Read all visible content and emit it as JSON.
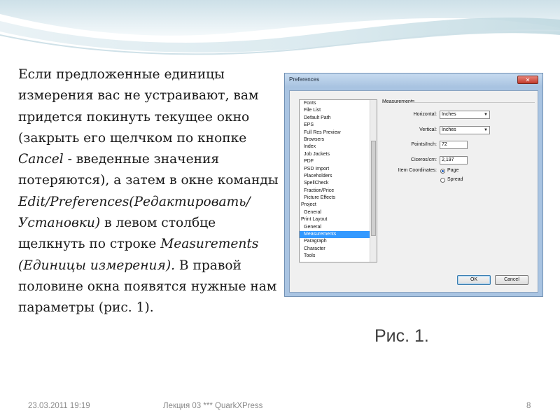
{
  "slide": {
    "paragraph": [
      {
        "text": "Если предложенные единицы измерения вас не устраивают, вам придется покинуть текущее окно (закрыть его щелчком по кнопке ",
        "italic": false
      },
      {
        "text": "Cancel",
        "italic": true
      },
      {
        "text": " - введенные значения потеряются), а затем в окне команды ",
        "italic": false
      },
      {
        "text": "Edit/Preferences(Редактировать/Установки)",
        "italic": true
      },
      {
        "text": " в левом столбце щелкнуть по строке ",
        "italic": false
      },
      {
        "text": "Measurements (Единицы измерения).",
        "italic": true
      },
      {
        "text": " В правой половине окна появятся нужные нам параметры (рис. 1).",
        "italic": false
      }
    ],
    "caption": "Рис. 1."
  },
  "dialog": {
    "title": "Preferences",
    "close_label": "✕",
    "categories": [
      {
        "label": "Fonts",
        "level": 1,
        "selected": false
      },
      {
        "label": "File List",
        "level": 1,
        "selected": false
      },
      {
        "label": "Default Path",
        "level": 1,
        "selected": false
      },
      {
        "label": "EPS",
        "level": 1,
        "selected": false
      },
      {
        "label": "Full Res Preview",
        "level": 1,
        "selected": false
      },
      {
        "label": "Browsers",
        "level": 1,
        "selected": false
      },
      {
        "label": "Index",
        "level": 1,
        "selected": false
      },
      {
        "label": "Job Jackets",
        "level": 1,
        "selected": false
      },
      {
        "label": "PDF",
        "level": 1,
        "selected": false
      },
      {
        "label": "PSD Import",
        "level": 1,
        "selected": false
      },
      {
        "label": "Placeholders",
        "level": 1,
        "selected": false
      },
      {
        "label": "SpellCheck",
        "level": 1,
        "selected": false
      },
      {
        "label": "Fraction/Price",
        "level": 1,
        "selected": false
      },
      {
        "label": "Picture Effects",
        "level": 1,
        "selected": false
      },
      {
        "label": "Project",
        "level": 0,
        "selected": false
      },
      {
        "label": "General",
        "level": 1,
        "selected": false
      },
      {
        "label": "Print Layout",
        "level": 0,
        "selected": false
      },
      {
        "label": "General",
        "level": 1,
        "selected": false
      },
      {
        "label": "Measurements",
        "level": 1,
        "selected": true
      },
      {
        "label": "Paragraph",
        "level": 1,
        "selected": false
      },
      {
        "label": "Character",
        "level": 1,
        "selected": false
      },
      {
        "label": "Tools",
        "level": 1,
        "selected": false
      }
    ],
    "measurements": {
      "section_title": "Measurements",
      "horizontal_label": "Horizontal:",
      "horizontal_value": "Inches",
      "vertical_label": "Vertical:",
      "vertical_value": "Inches",
      "points_label": "Points/Inch:",
      "points_value": "72",
      "ciceros_label": "Ciceros/cm:",
      "ciceros_value": "2,197",
      "item_coords_label": "Item Coordinates:",
      "option_page": "Page",
      "option_spread": "Spread",
      "selected_option": "Page"
    },
    "ok_label": "OK",
    "cancel_label": "Cancel"
  },
  "footer": {
    "date": "23.03.2011 19:19",
    "lecture": "Лекция 03  ***  QuarkXPress",
    "page": "8"
  },
  "colors": {
    "selection": "#3399ff",
    "dialog_frame": "#a9c4e2",
    "caption_text": "#3f3f3f",
    "footer_text": "#8a8a8a"
  }
}
